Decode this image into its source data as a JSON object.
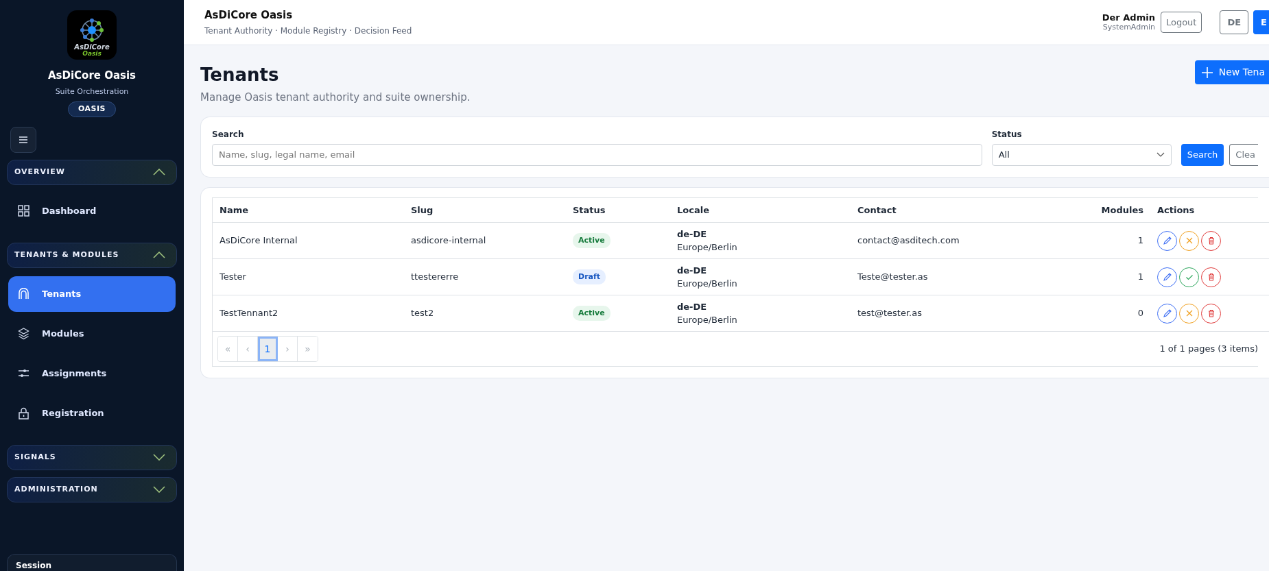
{
  "sidebar": {
    "logo": {
      "line_1": "AsDiCore",
      "line_2": "Oasis"
    },
    "brand": "AsDiCore Oasis",
    "subtitle": "Suite Orchestration",
    "pill": "OASIS",
    "groups": [
      {
        "label": "OVERVIEW",
        "expanded": true,
        "items": [
          {
            "label": "Dashboard",
            "selected": false
          }
        ]
      },
      {
        "label": "TENANTS & MODULES",
        "expanded": true,
        "items": [
          {
            "label": "Tenants",
            "selected": true
          },
          {
            "label": "Modules",
            "selected": false
          },
          {
            "label": "Assignments",
            "selected": false
          },
          {
            "label": "Registration",
            "selected": false
          }
        ]
      },
      {
        "label": "SIGNALS",
        "expanded": false
      },
      {
        "label": "ADMINISTRATION",
        "expanded": false
      }
    ],
    "session": "Session"
  },
  "header": {
    "title": "AsDiCore Oasis",
    "subtitle": "Tenant Authority · Module Registry · Decision Feed",
    "user": "Der Admin",
    "role": "SystemAdmin",
    "logout": "Logout",
    "languages": [
      {
        "label": "DE",
        "selected": false
      },
      {
        "label": "E",
        "selected": true
      }
    ]
  },
  "page": {
    "title": "Tenants",
    "description": "Manage Oasis tenant authority and suite ownership.",
    "new_button": "New Tena"
  },
  "filters": {
    "search_label": "Search",
    "search_placeholder": "Name, slug, legal name, email",
    "status_label": "Status",
    "status_value": "All",
    "search_button": "Search",
    "clear_button": "Clea"
  },
  "table": {
    "columns": [
      "Name",
      "Slug",
      "Status",
      "Locale",
      "Contact",
      "Modules",
      "Actions"
    ],
    "rows": [
      {
        "name": "AsDiCore Internal",
        "slug": "asdicore-internal",
        "status": "Active",
        "kind": "active",
        "locale": "de-DE",
        "timezone": "Europe/Berlin",
        "contact": "contact@asditech.com",
        "modules": "1",
        "actions": [
          {
            "kind": "edit"
          },
          {
            "kind": "deactivate"
          },
          {
            "kind": "delete"
          }
        ]
      },
      {
        "name": "Tester",
        "slug": "ttestererre",
        "status": "Draft",
        "kind": "draft",
        "locale": "de-DE",
        "timezone": "Europe/Berlin",
        "contact": "Teste@tester.as",
        "modules": "1",
        "actions": [
          {
            "kind": "edit"
          },
          {
            "kind": "activate"
          },
          {
            "kind": "delete"
          }
        ]
      },
      {
        "name": "TestTennant2",
        "slug": "test2",
        "status": "Active",
        "kind": "active",
        "locale": "de-DE",
        "timezone": "Europe/Berlin",
        "contact": "test@tester.as",
        "modules": "0",
        "actions": [
          {
            "kind": "edit"
          },
          {
            "kind": "deactivate"
          },
          {
            "kind": "delete"
          }
        ]
      }
    ],
    "pagination": {
      "pages": [
        {
          "label": "«",
          "selected": false
        },
        {
          "label": "‹",
          "selected": false
        },
        {
          "label": "1",
          "selected": true
        },
        {
          "label": "›",
          "selected": false
        },
        {
          "label": "»",
          "selected": false
        }
      ],
      "summary": "1 of 1 pages (3 items)"
    }
  }
}
